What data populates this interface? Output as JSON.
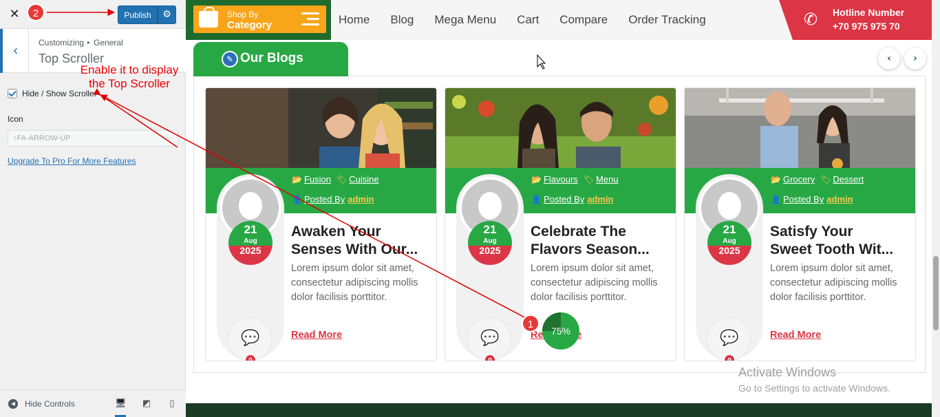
{
  "customizer": {
    "publish_label": "Publish",
    "breadcrumb_root": "Customizing",
    "breadcrumb_section": "General",
    "section_title": "Top Scroller",
    "checkbox_label": "Hide / Show Scroller",
    "icon_label": "Icon",
    "icon_select_value": "FA-ARROW-UP",
    "upgrade_link": "Upgrade To Pro For More Features",
    "hide_controls": "Hide Controls"
  },
  "annotations": {
    "badge_1": "1",
    "badge_2": "2",
    "enable_text_line1": "Enable it to display",
    "enable_text_line2": "the Top Scroller",
    "color": "#e00000"
  },
  "header": {
    "category_small": "Shop By",
    "category_big": "Category",
    "nav": [
      "Home",
      "Blog",
      "Mega Menu",
      "Cart",
      "Compare",
      "Order Tracking"
    ],
    "hotline_title": "Hotline Number",
    "hotline_number": "+70 975 975 70"
  },
  "blog": {
    "section_title": "Our Blogs",
    "posted_by_label": "Posted By",
    "author": "admin",
    "read_more": "Read More",
    "cards": [
      {
        "tags": [
          "Fusion",
          "Cuisine"
        ],
        "day": "21",
        "month": "Aug",
        "year": "2025",
        "title_line1": "Awaken Your",
        "title_line2": "Senses With Our...",
        "desc": "Lorem ipsum dolor sit amet, consectetur adipiscing mollis dolor facilisis porttitor.",
        "comments": "0"
      },
      {
        "tags": [
          "Flavours",
          "Menu"
        ],
        "day": "21",
        "month": "Aug",
        "year": "2025",
        "title_line1": "Celebrate The",
        "title_line2": "Flavors Season...",
        "desc": "Lorem ipsum dolor sit amet, consectetur adipiscing mollis dolor facilisis porttitor.",
        "comments": "0"
      },
      {
        "tags": [
          "Grocery",
          "Dessert"
        ],
        "day": "21",
        "month": "Aug",
        "year": "2025",
        "title_line1": "Satisfy Your",
        "title_line2": "Sweet Tooth Wit...",
        "desc": "Lorem ipsum dolor sit amet, consectetur adipiscing mollis dolor facilisis porttitor.",
        "comments": "0"
      }
    ]
  },
  "scroller": {
    "progress_label": "75%",
    "progress": 0.75
  },
  "windows_watermark": {
    "title": "Activate Windows",
    "subtitle": "Go to Settings to activate Windows."
  },
  "colors": {
    "green": "#27a844",
    "dark_green": "#1f6b2d",
    "red": "#dc3545",
    "orange": "#f9a51a",
    "wp_blue": "#2271b1"
  }
}
